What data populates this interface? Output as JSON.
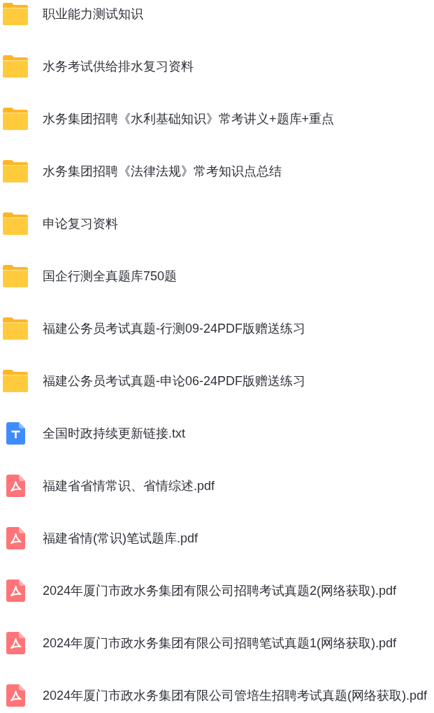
{
  "files": [
    {
      "kind": "folder",
      "name": "职业能力测试知识"
    },
    {
      "kind": "folder",
      "name": "水务考试供给排水复习资料"
    },
    {
      "kind": "folder",
      "name": "水务集团招聘《水利基础知识》常考讲义+题库+重点"
    },
    {
      "kind": "folder",
      "name": "水务集团招聘《法律法规》常考知识点总结"
    },
    {
      "kind": "folder",
      "name": "申论复习资料"
    },
    {
      "kind": "folder",
      "name": "国企行测全真题库750题"
    },
    {
      "kind": "folder",
      "name": "福建公务员考试真题-行测09-24PDF版赠送练习"
    },
    {
      "kind": "folder",
      "name": "福建公务员考试真题-申论06-24PDF版赠送练习"
    },
    {
      "kind": "txt",
      "name": "全国时政持续更新链接.txt"
    },
    {
      "kind": "pdf",
      "name": "福建省省情常识、省情综述.pdf"
    },
    {
      "kind": "pdf",
      "name": "福建省情(常识)笔试题库.pdf"
    },
    {
      "kind": "pdf",
      "name": "2024年厦门市政水务集团有限公司招聘考试真题2(网络获取).pdf"
    },
    {
      "kind": "pdf",
      "name": "2024年厦门市政水务集团有限公司招聘笔试真题1(网络获取).pdf"
    },
    {
      "kind": "pdf",
      "name": "2024年厦门市政水务集团有限公司管培生招聘考试真题(网络获取).pdf"
    }
  ]
}
